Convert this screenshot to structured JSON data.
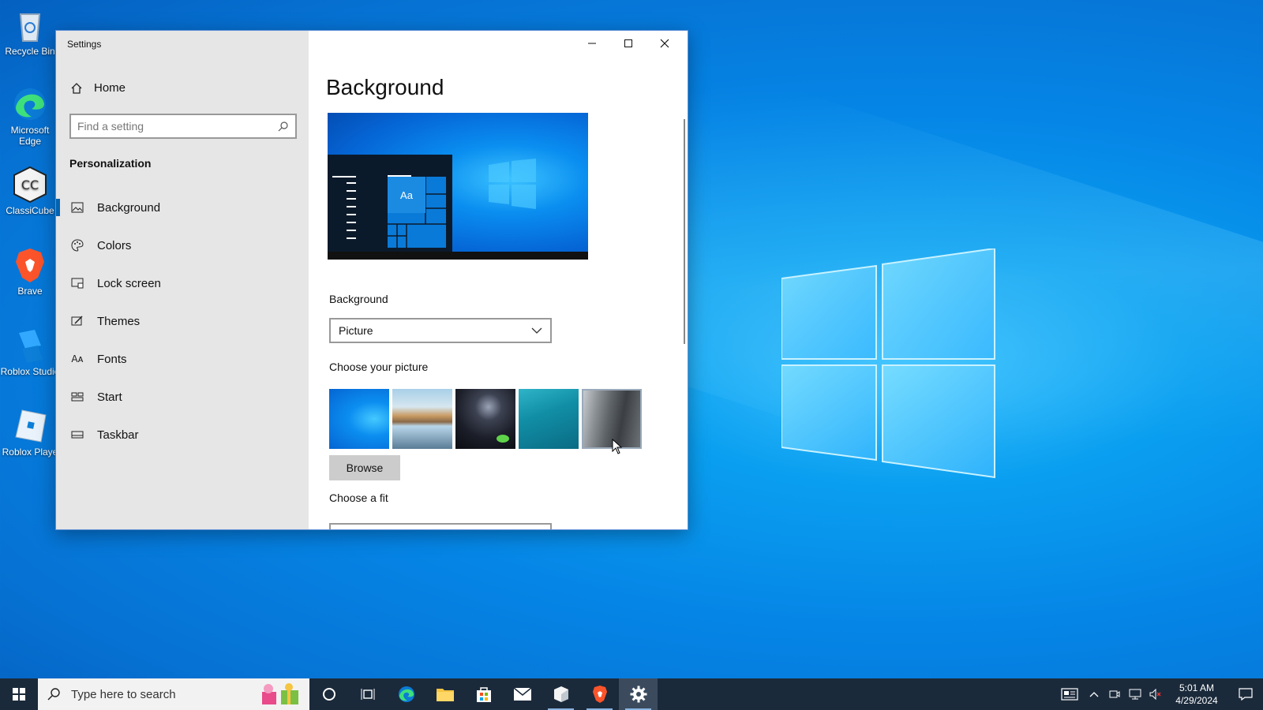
{
  "desktop": {
    "icons": [
      {
        "label": "Recycle Bin"
      },
      {
        "label": "Microsoft Edge"
      },
      {
        "label": "ClassiCube"
      },
      {
        "label": "Brave"
      },
      {
        "label": "Roblox Studio"
      },
      {
        "label": "Roblox Playe"
      }
    ]
  },
  "window": {
    "title": "Settings",
    "controls": {
      "minimize": "—",
      "maximize": "☐",
      "close": "✕"
    }
  },
  "sidebar": {
    "home_label": "Home",
    "search_placeholder": "Find a setting",
    "section_title": "Personalization",
    "items": [
      {
        "label": "Background",
        "icon": "picture-icon",
        "active": true
      },
      {
        "label": "Colors",
        "icon": "palette-icon"
      },
      {
        "label": "Lock screen",
        "icon": "lock-screen-icon"
      },
      {
        "label": "Themes",
        "icon": "themes-icon"
      },
      {
        "label": "Fonts",
        "icon": "fonts-icon"
      },
      {
        "label": "Start",
        "icon": "start-icon"
      },
      {
        "label": "Taskbar",
        "icon": "taskbar-icon"
      }
    ]
  },
  "main": {
    "page_title": "Background",
    "preview": {
      "tile_label": "Aa"
    },
    "background_label": "Background",
    "background_value": "Picture",
    "choose_picture_label": "Choose your picture",
    "browse_label": "Browse",
    "choose_fit_label": "Choose a fit"
  },
  "taskbar": {
    "search_placeholder": "Type here to search",
    "time": "5:01 AM",
    "date": "4/29/2024"
  },
  "colors": {
    "accent": "#0063b1",
    "taskbar": "#1b2a3b"
  }
}
